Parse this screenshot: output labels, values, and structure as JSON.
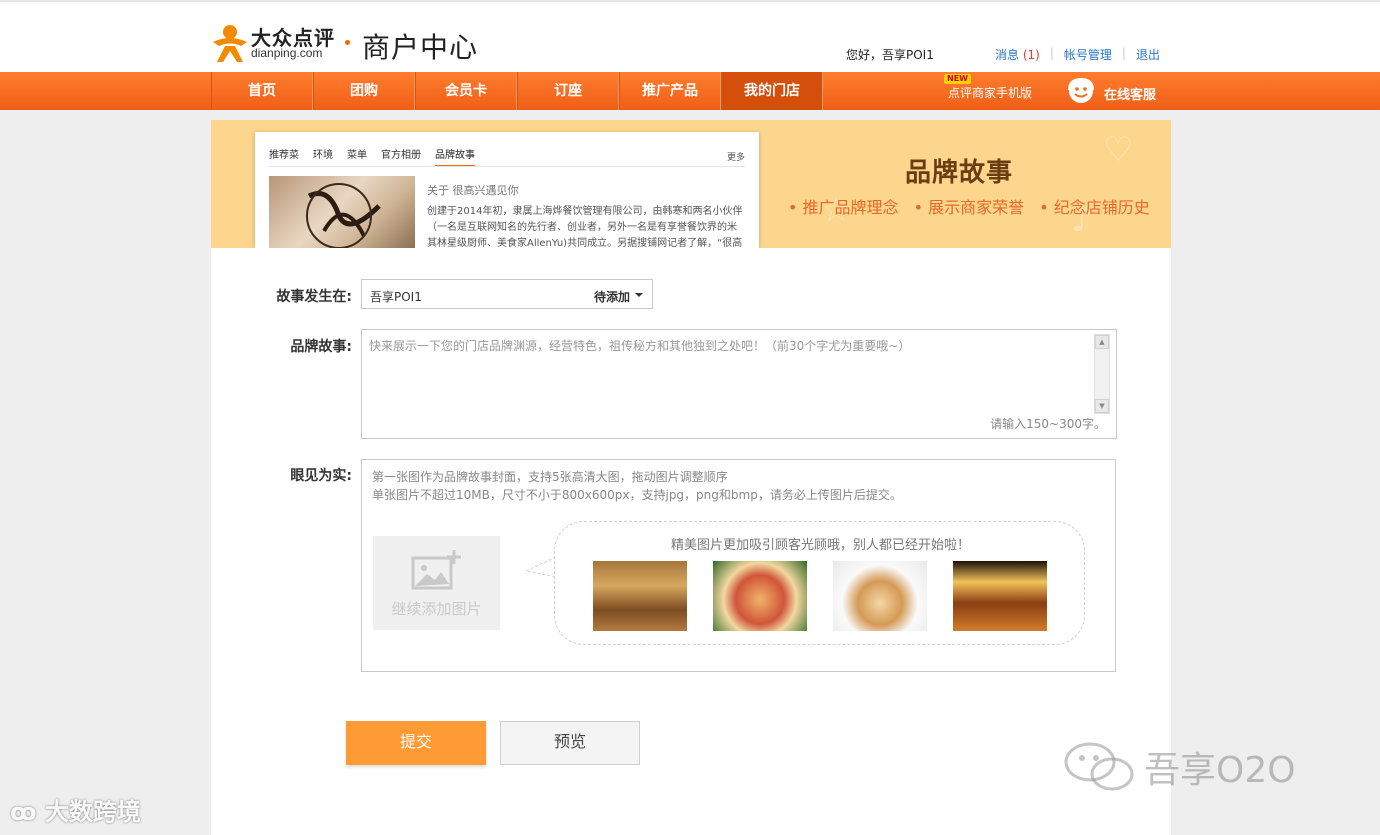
{
  "header": {
    "logo_cn": "大众点评",
    "logo_en": "dianping.com",
    "site_title": "商户中心",
    "greeting": "您好，吾享POI1",
    "links": {
      "messages": "消息",
      "messages_count": "(1)",
      "account": "帐号管理",
      "logout": "退出"
    }
  },
  "nav": {
    "items": [
      {
        "label": "首页"
      },
      {
        "label": "团购"
      },
      {
        "label": "会员卡"
      },
      {
        "label": "订座"
      },
      {
        "label": "推广产品"
      },
      {
        "label": "我的门店"
      }
    ],
    "active_index": 5,
    "new_badge": "NEW",
    "mobile_link": "点评商家手机版",
    "customer_service": "在线客服"
  },
  "banner": {
    "preview_tabs": [
      "推荐菜",
      "环境",
      "菜单",
      "官方相册",
      "品牌故事"
    ],
    "preview_more": "更多",
    "preview_subtitle": "关于 很高兴遇见你",
    "preview_text": "创建于2014年初，隶属上海烨餐饮管理有限公司，由韩寒和两名小伙伴（一名是互联网知名的先行者、创业者，另外一名是有享誉餐饮界的米其林星级厨师、美食家AllenYu)共同成立。另据搜铺网记者了解，“很高兴遇",
    "title": "品牌故事",
    "tags": [
      "• 推广品牌理念",
      "• 展示商家荣誉",
      "• 纪念店铺历史"
    ]
  },
  "form": {
    "location_label": "故事发生在:",
    "location_value": "吾享POI1",
    "location_status": "待添加",
    "story_label": "品牌故事:",
    "story_placeholder": "快来展示一下您的门店品牌渊源，经营特色，祖传秘方和其他独到之处吧！（前30个字尤为重要哦~）",
    "story_hint": "请输入150~300字。",
    "photos_label": "眼见为实:",
    "photos_tip1": "第一张图作为品牌故事封面，支持5张高清大图，拖动图片调整顺序",
    "photos_tip2": "单张图片不超过10MB，尺寸不小于800x600px，支持jpg，png和bmp，请务必上传图片后提交。",
    "add_photo_label": "继续添加图片",
    "bubble_text": "精美图片更加吸引顾客光顾哦，别人都已经开始啦！",
    "submit_label": "提交",
    "preview_label": "预览"
  },
  "watermarks": {
    "left": "大数跨境",
    "right": "吾享O2O"
  },
  "colors": {
    "nav_orange": "#f26a22",
    "banner_yellow": "#fcd68c",
    "submit_orange": "#ff9b34",
    "link_blue": "#2a78c0"
  }
}
